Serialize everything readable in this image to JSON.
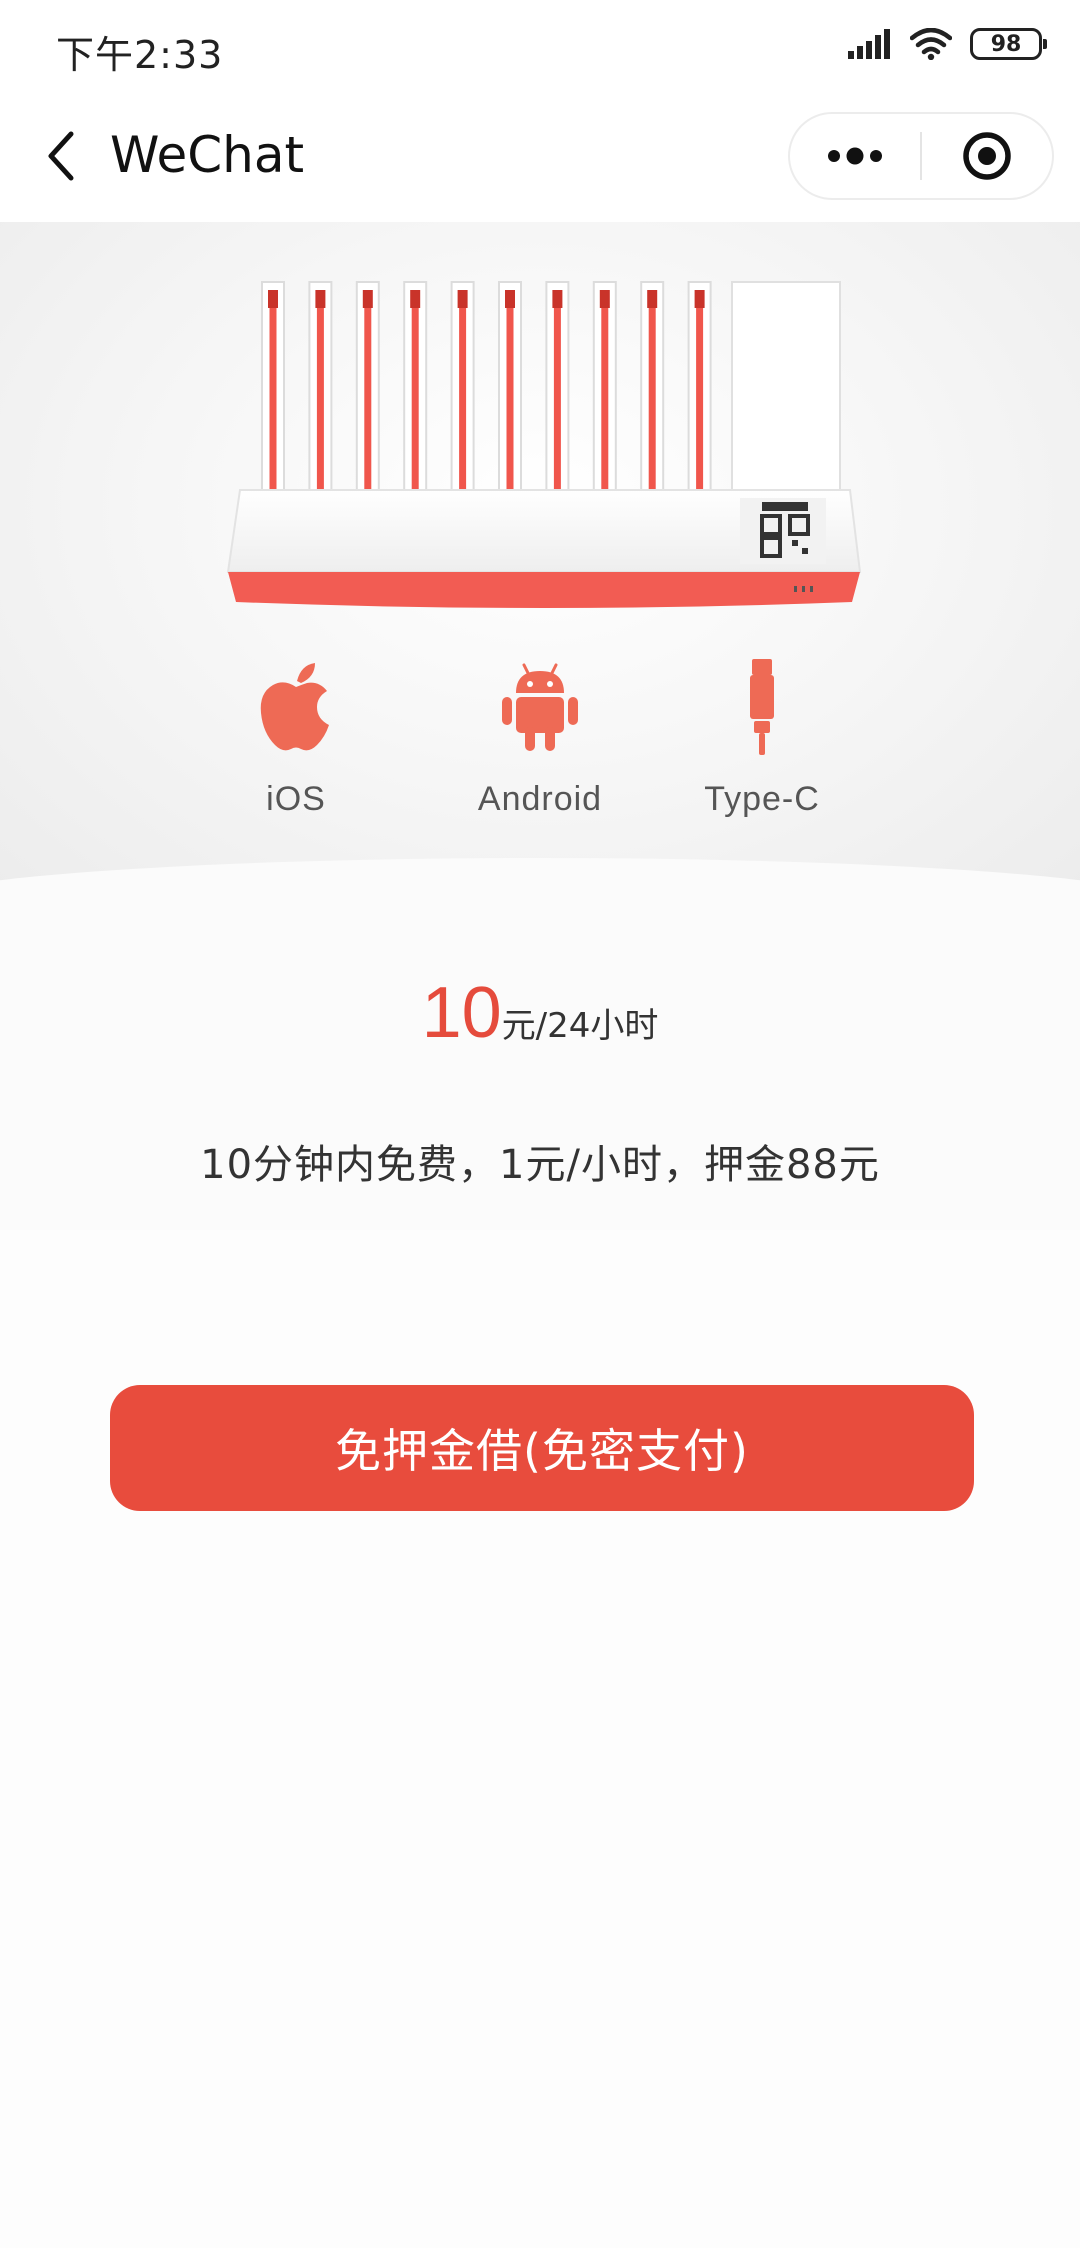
{
  "status_bar": {
    "time": "下午2:33",
    "battery": "98",
    "signal_icon": "signal-bars-icon",
    "wifi_icon": "wifi-icon"
  },
  "nav": {
    "title": "WeChat",
    "back_icon": "back-arrow-icon",
    "more_icon": "more-dots-icon",
    "close_icon": "close-target-icon"
  },
  "hero": {
    "device_icon": "charging-station-illustration",
    "platforms": [
      {
        "label": "iOS",
        "icon": "apple-icon"
      },
      {
        "label": "Android",
        "icon": "android-icon"
      },
      {
        "label": "Type-C",
        "icon": "usb-type-c-icon"
      }
    ]
  },
  "pricing": {
    "price": "10",
    "unit": "元/24小时",
    "rule": "10分钟内免费，1元/小时，押金88元"
  },
  "action": {
    "borrow_label": "免押金借(免密支付)"
  },
  "colors": {
    "accent": "#e84c3d",
    "price": "#e54b3c",
    "text": "#333333"
  }
}
